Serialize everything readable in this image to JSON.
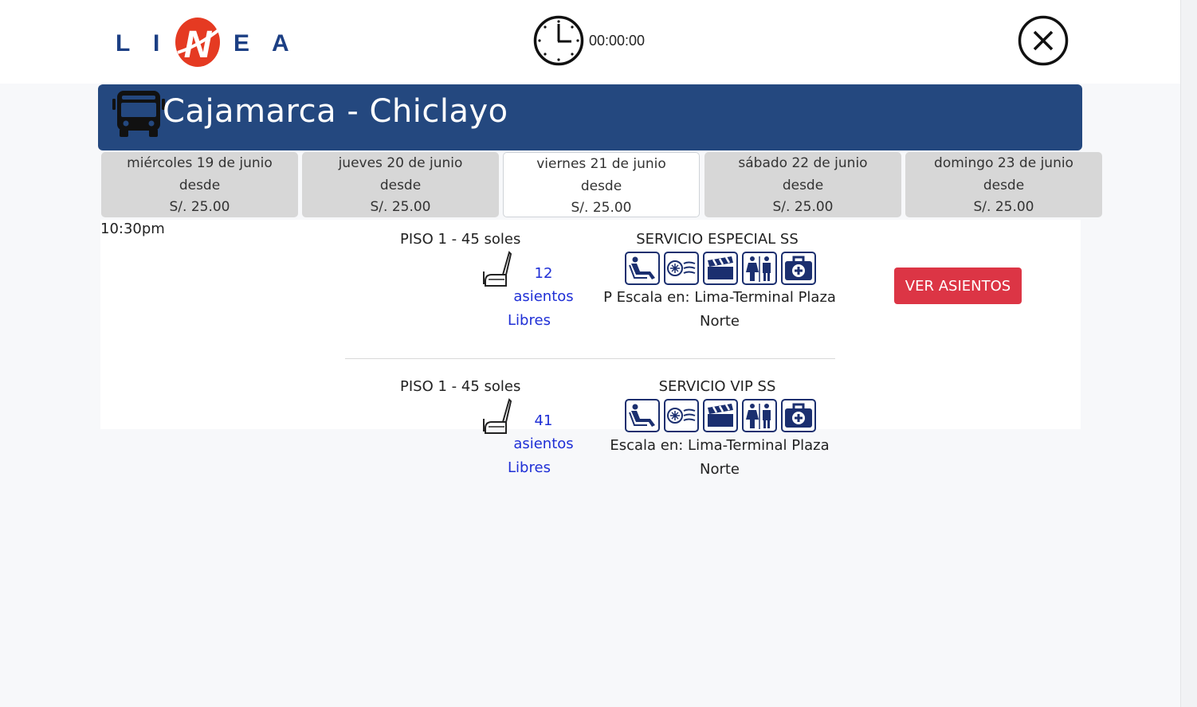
{
  "brand": {
    "logo_text": "LINEA",
    "accent": "#e53a22",
    "navy": "#24487f"
  },
  "timer": {
    "value": "00:00:00"
  },
  "route": {
    "title": "Cajamarca - Chiclayo"
  },
  "dates": [
    {
      "day": "miércoles 19 de junio",
      "from_label": "desde",
      "price": "S/. 25.00",
      "active": false
    },
    {
      "day": "jueves 20 de junio",
      "from_label": "desde",
      "price": "S/. 25.00",
      "active": false
    },
    {
      "day": "viernes 21 de junio",
      "from_label": "desde",
      "price": "S/. 25.00",
      "active": true
    },
    {
      "day": "sábado 22 de junio",
      "from_label": "desde",
      "price": "S/. 25.00",
      "active": false
    },
    {
      "day": "domingo 23 de junio",
      "from_label": "desde",
      "price": "S/. 25.00",
      "active": false
    }
  ],
  "departure": {
    "time": "10:30pm",
    "button_label": "VER ASIENTOS",
    "options": [
      {
        "floor": "PISO 1 - 45 soles",
        "seats_count": "12",
        "seats_word": "asientos",
        "seats_free": "Libres",
        "service": "SERVICIO ESPECIAL SS",
        "stop_line1": "P Escala en: Lima-Terminal Plaza",
        "stop_line2": "Norte"
      },
      {
        "floor": "PISO 1 - 45 soles",
        "seats_count": "41",
        "seats_word": "asientos",
        "seats_free": "Libres",
        "service": "SERVICIO VIP SS",
        "stop_line1": "Escala en: Lima-Terminal Plaza",
        "stop_line2": "Norte"
      }
    ]
  },
  "amenity_icons": [
    "reclining-seat-icon",
    "air-conditioning-icon",
    "movie-clapperboard-icon",
    "restroom-icon",
    "first-aid-kit-icon"
  ]
}
